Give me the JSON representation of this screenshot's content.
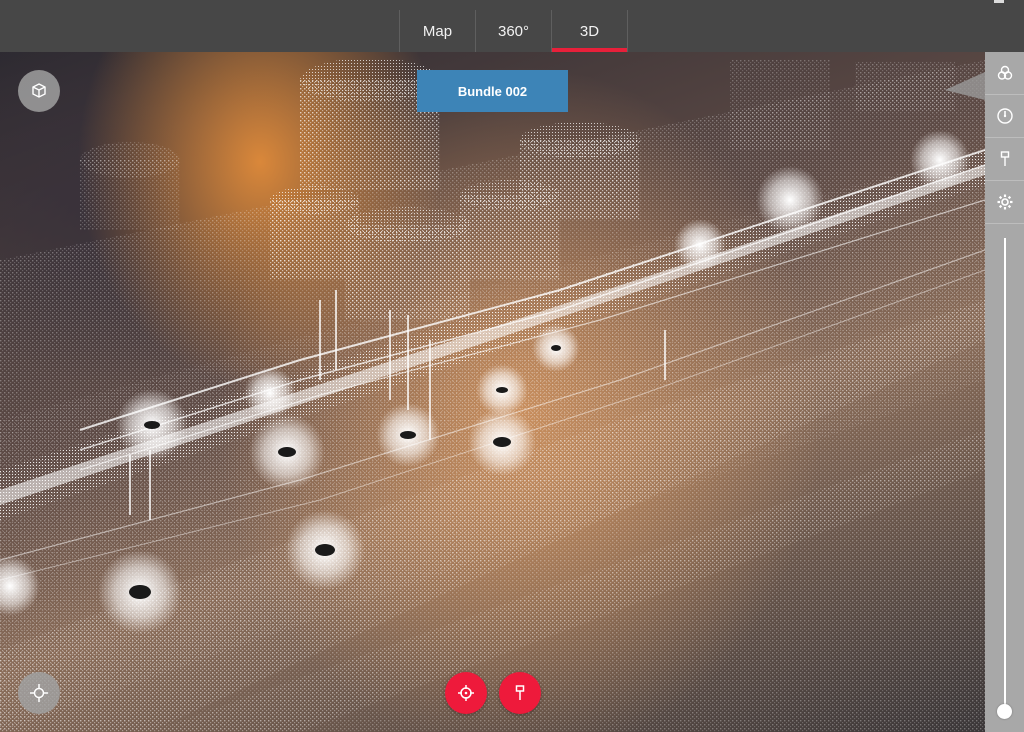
{
  "tabs": [
    {
      "label": "Map",
      "active": false
    },
    {
      "label": "360°",
      "active": false
    },
    {
      "label": "3D",
      "active": true
    }
  ],
  "bundle_label": "Bundle 002",
  "colors": {
    "topbar": "#474747",
    "accent": "#e8203a",
    "bundle_label_bg": "#3d84b7",
    "action_button": "#ee1a3b",
    "side_panel": "#a8a8a8"
  },
  "icons": {
    "view_cube": "cube-icon",
    "navigate": "crosshair-move-icon",
    "target_action": "target-icon",
    "pin_action": "pin-icon",
    "layers": "layers-icon",
    "compass": "compass-icon",
    "markers": "pin-icon",
    "settings": "gear-icon"
  },
  "slider": {
    "value": 0
  }
}
